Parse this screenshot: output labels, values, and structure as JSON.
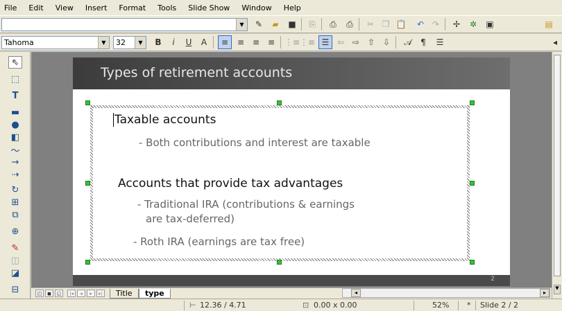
{
  "menu": [
    {
      "label": "File"
    },
    {
      "label": "Edit"
    },
    {
      "label": "View"
    },
    {
      "label": "Insert"
    },
    {
      "label": "Format"
    },
    {
      "label": "Tools"
    },
    {
      "label": "Slide Show"
    },
    {
      "label": "Window"
    },
    {
      "label": "Help"
    }
  ],
  "toolbar": {
    "font_name": "Tahoma",
    "font_size": "32"
  },
  "slide": {
    "title": "Types of retirement accounts",
    "lines": {
      "l1": "Taxable accounts",
      "l2": "- Both contributions and interest are taxable",
      "l3": "Accounts that provide tax advantages",
      "l4a": "- Traditional IRA (contributions & earnings",
      "l4b": "are tax-deferred)",
      "l5": "- Roth IRA (earnings are tax free)"
    },
    "page_number": "2"
  },
  "tabs": [
    {
      "label": "Title"
    },
    {
      "label": "type"
    }
  ],
  "status": {
    "position": "12.36 / 4.71",
    "size": "0.00 x 0.00",
    "zoom": "52%",
    "modified": "*",
    "slide": "Slide 2 / 2"
  },
  "colors": {
    "header_bg": "#4a4a4a",
    "handle_green": "#3ac13a",
    "chrome": "#ece9d8"
  }
}
